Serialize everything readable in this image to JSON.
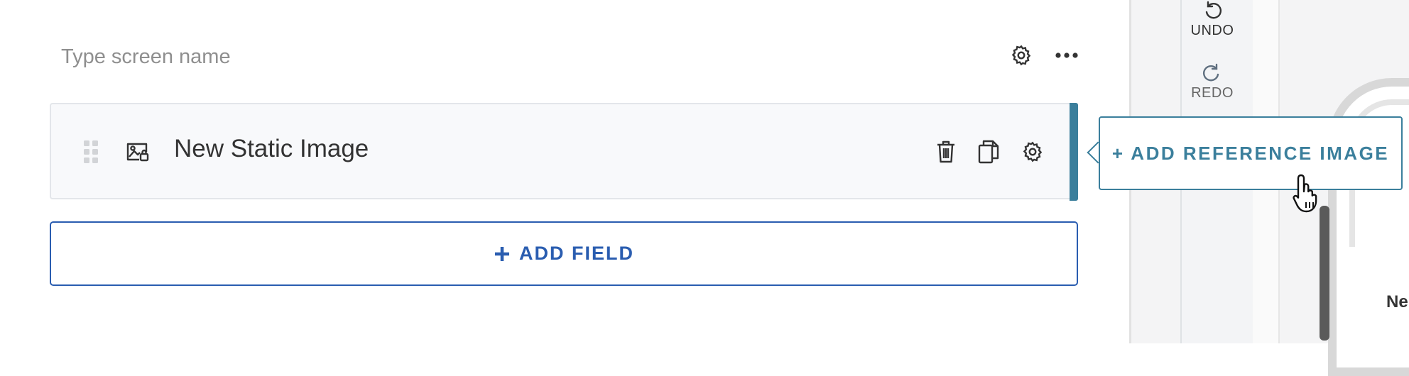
{
  "screen": {
    "name_placeholder": "Type screen name",
    "name_value": ""
  },
  "toolbar": {
    "settings_icon": "gear-icon",
    "more_icon": "ellipsis-icon"
  },
  "field": {
    "label": "New Static Image",
    "type_icon": "image-icon",
    "actions": [
      "trash-icon",
      "copy-icon",
      "gear-icon"
    ]
  },
  "add_field": {
    "label": "ADD FIELD",
    "icon": "plus-icon"
  },
  "history": {
    "undo_label": "UNDO",
    "redo_label": "REDO"
  },
  "reference": {
    "label": "+ ADD REFERENCE IMAGE"
  },
  "preview": {
    "peek_text": "Ne"
  },
  "colors": {
    "accent_teal": "#3b7f9c",
    "primary_blue": "#2a5db0",
    "placeholder_gray": "#8f8f8f"
  }
}
